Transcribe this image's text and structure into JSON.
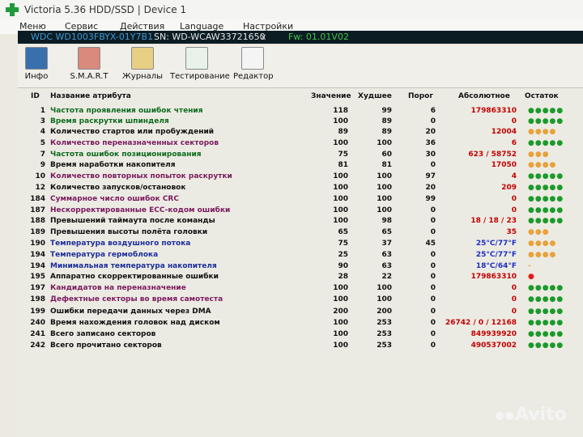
{
  "title": "Victoria 5.36 HDD/SSD | Device 1",
  "menu": [
    "Меню",
    "Сервис",
    "Действия",
    "Language",
    "Настройки"
  ],
  "device": {
    "model": "WDC WD1003FBYX-01Y7B1",
    "serial": "SN: WD-WCAW33721650",
    "close": "x",
    "fw": "Fw: 01.01V02"
  },
  "toolbar": [
    {
      "label": "Инфо",
      "icon": "info-icon"
    },
    {
      "label": "S.M.A.R.T",
      "icon": "bar-chart-icon"
    },
    {
      "label": "Журналы",
      "icon": "log-icon"
    },
    {
      "label": "Тестирование",
      "icon": "first-aid-icon"
    },
    {
      "label": "Редактор",
      "icon": "binary-editor-icon"
    }
  ],
  "headers": {
    "id": "ID",
    "name": "Название атрибута",
    "value": "Значение",
    "worst": "Худшее",
    "threshold": "Порог",
    "raw": "Абсолютное",
    "health": "Остаток"
  },
  "colors": {
    "green": "#0e6b1f",
    "purple": "#7a1a5e",
    "navy": "#1c2d9c",
    "black": "#111111",
    "red": "#c40000",
    "blue": "#1e2fbf",
    "health_green": "#1b9a2b",
    "health_orange": "#e8a23a",
    "health_red": "#e41b1b"
  },
  "rows": [
    {
      "id": "1",
      "name": "Частота проявления ошибок чтения",
      "value": "118",
      "worst": "99",
      "threshold": "6",
      "raw": "179863310",
      "health": "●●●●●",
      "name_color": "green",
      "raw_color": "red",
      "health_color": "health_green"
    },
    {
      "id": "3",
      "name": "Время раскрутки шпинделя",
      "value": "100",
      "worst": "89",
      "threshold": "0",
      "raw": "0",
      "health": "●●●●●",
      "name_color": "green",
      "raw_color": "red",
      "health_color": "health_green"
    },
    {
      "id": "4",
      "name": "Количество стартов или пробуждений",
      "value": "89",
      "worst": "89",
      "threshold": "20",
      "raw": "12004",
      "health": "●●●●",
      "name_color": "black",
      "raw_color": "red",
      "health_color": "health_orange"
    },
    {
      "id": "5",
      "name": "Количество переназначенных секторов",
      "value": "100",
      "worst": "100",
      "threshold": "36",
      "raw": "6",
      "health": "●●●●●",
      "name_color": "purple",
      "raw_color": "red",
      "health_color": "health_green"
    },
    {
      "id": "7",
      "name": "Частота ошибок позиционирования",
      "value": "75",
      "worst": "60",
      "threshold": "30",
      "raw": "623 / 58752",
      "health": "●●●",
      "name_color": "green",
      "raw_color": "red",
      "health_color": "health_orange"
    },
    {
      "id": "9",
      "name": "Время наработки накопителя",
      "value": "81",
      "worst": "81",
      "threshold": "0",
      "raw": "17050",
      "health": "●●●●",
      "name_color": "black",
      "raw_color": "red",
      "health_color": "health_orange"
    },
    {
      "id": "10",
      "name": "Количество повторных попыток раскрутки",
      "value": "100",
      "worst": "100",
      "threshold": "97",
      "raw": "4",
      "health": "●●●●●",
      "name_color": "purple",
      "raw_color": "red",
      "health_color": "health_green"
    },
    {
      "id": "12",
      "name": "Количество запусков/остановок",
      "value": "100",
      "worst": "100",
      "threshold": "20",
      "raw": "209",
      "health": "●●●●●",
      "name_color": "black",
      "raw_color": "red",
      "health_color": "health_green"
    },
    {
      "id": "184",
      "name": "Суммарное число ошибок CRC",
      "value": "100",
      "worst": "100",
      "threshold": "99",
      "raw": "0",
      "health": "●●●●●",
      "name_color": "purple",
      "raw_color": "red",
      "health_color": "health_green"
    },
    {
      "id": "187",
      "name": "Нескорректированные ECC-кодом ошибки",
      "value": "100",
      "worst": "100",
      "threshold": "0",
      "raw": "0",
      "health": "●●●●●",
      "name_color": "purple",
      "raw_color": "red",
      "health_color": "health_green"
    },
    {
      "id": "188",
      "name": "Превышений таймаута после команды",
      "value": "100",
      "worst": "98",
      "threshold": "0",
      "raw": "18 / 18 / 23",
      "health": "●●●●●",
      "name_color": "black",
      "raw_color": "red",
      "health_color": "health_green"
    },
    {
      "id": "189",
      "name": "Превышения высоты полёта головки",
      "value": "65",
      "worst": "65",
      "threshold": "0",
      "raw": "35",
      "health": "●●●",
      "name_color": "black",
      "raw_color": "red",
      "health_color": "health_orange"
    },
    {
      "id": "190",
      "name": "Температура воздушного потока",
      "value": "75",
      "worst": "37",
      "threshold": "45",
      "raw": "25°C/77°F",
      "health": "●●●●",
      "name_color": "navy",
      "raw_color": "blue",
      "health_color": "health_orange"
    },
    {
      "id": "194",
      "name": "Температура гермоблока",
      "value": "25",
      "worst": "63",
      "threshold": "0",
      "raw": "25°C/77°F",
      "health": "●●●●",
      "name_color": "navy",
      "raw_color": "blue",
      "health_color": "health_orange"
    },
    {
      "id": "194",
      "name": "Минимальная температура накопителя",
      "value": "90",
      "worst": "63",
      "threshold": "0",
      "raw": "18°C/64°F",
      "health": "-",
      "name_color": "navy",
      "raw_color": "blue",
      "health_color": "health_orange"
    },
    {
      "id": "195",
      "name": "Аппаратно скорректированные ошибки",
      "value": "28",
      "worst": "22",
      "threshold": "0",
      "raw": "179863310",
      "health": "●",
      "name_color": "black",
      "raw_color": "red",
      "health_color": "health_red"
    },
    {
      "id": "197",
      "name": "Кандидатов на переназначение",
      "value": "100",
      "worst": "100",
      "threshold": "0",
      "raw": "0",
      "health": "●●●●●",
      "name_color": "purple",
      "raw_color": "red",
      "health_color": "health_green"
    },
    {
      "id": "198",
      "name": "Дефектные секторы во время самотеста",
      "value": "100",
      "worst": "100",
      "threshold": "0",
      "raw": "0",
      "health": "●●●●●",
      "name_color": "purple",
      "raw_color": "red",
      "health_color": "health_green"
    },
    {
      "id": "199",
      "name": "Ошибки передачи данных через DMA",
      "value": "200",
      "worst": "200",
      "threshold": "0",
      "raw": "0",
      "health": "●●●●●",
      "name_color": "black",
      "raw_color": "red",
      "health_color": "health_green"
    },
    {
      "id": "240",
      "name": "Время нахождения головок над диском",
      "value": "100",
      "worst": "253",
      "threshold": "0",
      "raw": "26742 / 0 / 12168",
      "health": "●●●●●",
      "name_color": "black",
      "raw_color": "red",
      "health_color": "health_green"
    },
    {
      "id": "241",
      "name": "Всего записано секторов",
      "value": "100",
      "worst": "253",
      "threshold": "0",
      "raw": "849939920",
      "health": "●●●●●",
      "name_color": "black",
      "raw_color": "red",
      "health_color": "health_green"
    },
    {
      "id": "242",
      "name": "Всего прочитано секторов",
      "value": "100",
      "worst": "253",
      "threshold": "0",
      "raw": "490537002",
      "health": "●●●●●",
      "name_color": "black",
      "raw_color": "red",
      "health_color": "health_green"
    }
  ],
  "watermark": "Avito"
}
